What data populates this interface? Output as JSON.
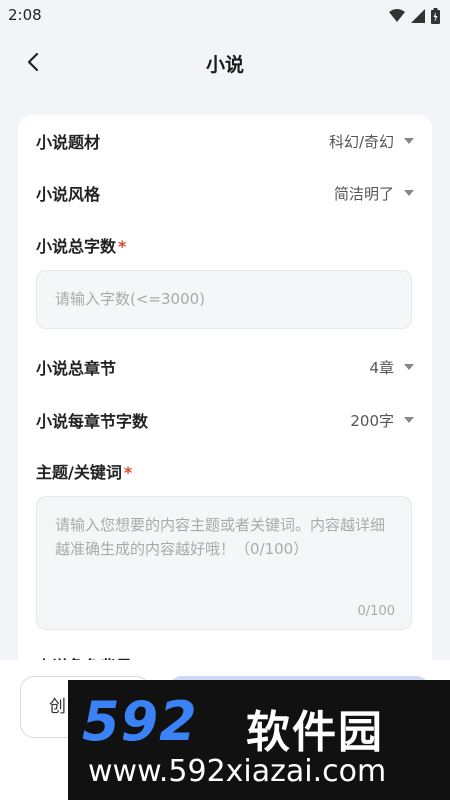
{
  "status": {
    "time": "2:08"
  },
  "header": {
    "title": "小说"
  },
  "form": {
    "genre": {
      "label": "小说题材",
      "value": "科幻/奇幻"
    },
    "style": {
      "label": "小说风格",
      "value": "简洁明了"
    },
    "word_count": {
      "label": "小说总字数",
      "required_mark": "*",
      "placeholder": "请输入字数(<=3000)"
    },
    "chapters": {
      "label": "小说总章节",
      "value": "4章"
    },
    "chapter_words": {
      "label": "小说每章节字数",
      "value": "200字"
    },
    "keywords": {
      "label": "主题/关键词",
      "required_mark": "*",
      "placeholder": "请输入您想要的内容主题或者关键词。内容越详细越准确生成的内容越好哦！（0/100）",
      "counter": "0/100"
    },
    "partial_label": "小说角色背景"
  },
  "bottom": {
    "left_button": "创"
  },
  "watermark": {
    "logo": "592",
    "brand": "软件园",
    "url": "www.592xiazai.com"
  },
  "colors": {
    "accent": "#cfd9f3",
    "required": "#e0462f",
    "watermark_blue": "#3b82f6"
  }
}
